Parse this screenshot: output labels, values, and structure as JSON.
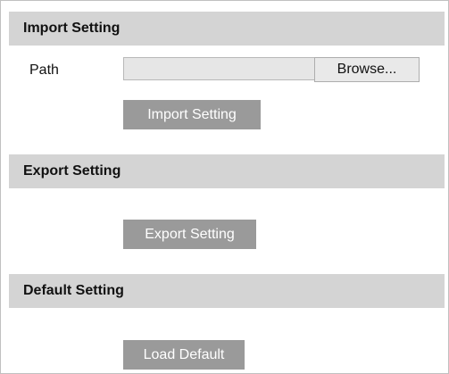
{
  "import_section": {
    "title": "Import Setting",
    "path_label": "Path",
    "path_value": "",
    "browse_label": "Browse...",
    "import_button_label": "Import Setting"
  },
  "export_section": {
    "title": "Export Setting",
    "export_button_label": "Export Setting"
  },
  "default_section": {
    "title": "Default Setting",
    "load_default_label": "Load Default"
  },
  "colors": {
    "section_header_bg": "#d4d4d4",
    "action_button_bg": "#9a9a9a",
    "action_button_text": "#ffffff",
    "input_bg": "#e6e6e6"
  }
}
